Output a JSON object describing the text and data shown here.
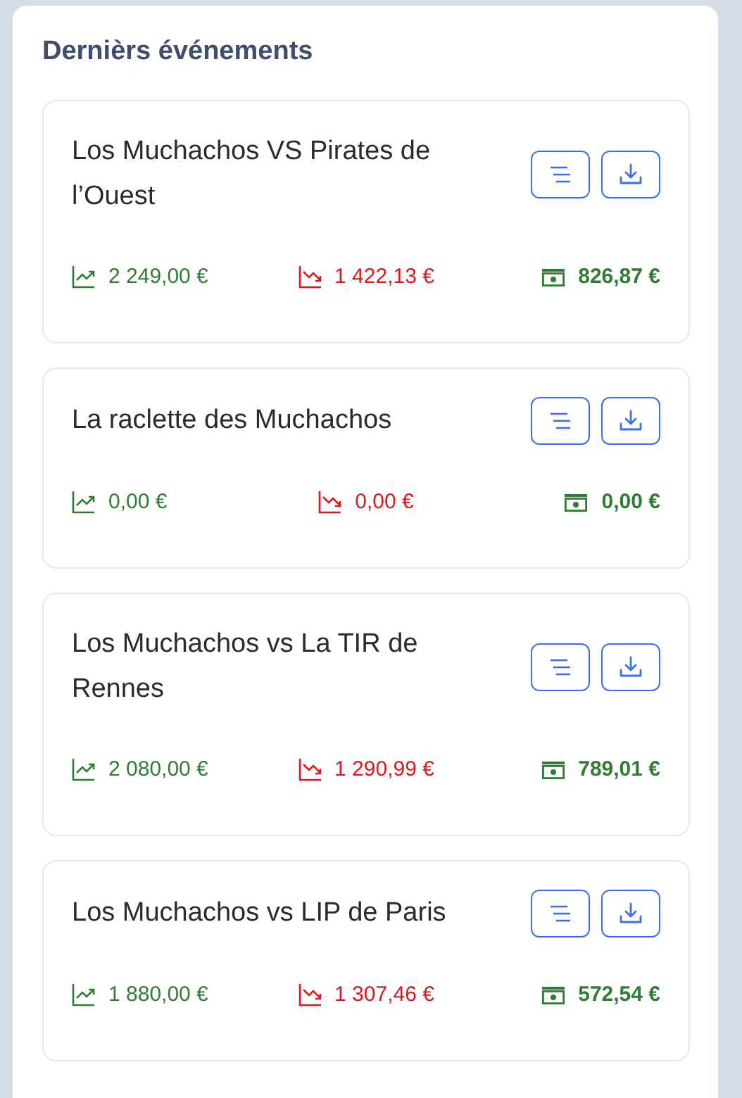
{
  "panel": {
    "title": "Dernièrs événements"
  },
  "events": [
    {
      "name": "Los Muchachos VS Pirates de l’Ouest",
      "income": "2 249,00 €",
      "expenses": "1 422,13 €",
      "net": "826,87 €"
    },
    {
      "name": "La raclette des Muchachos",
      "income": "0,00 €",
      "expenses": "0,00 €",
      "net": "0,00 €"
    },
    {
      "name": "Los Muchachos vs La TIR de Rennes",
      "income": "2 080,00 €",
      "expenses": "1 290,99 €",
      "net": "789,01 €"
    },
    {
      "name": "Los Muchachos vs LIP de Paris",
      "income": "1 880,00 €",
      "expenses": "1 307,46 €",
      "net": "572,54 €"
    }
  ]
}
